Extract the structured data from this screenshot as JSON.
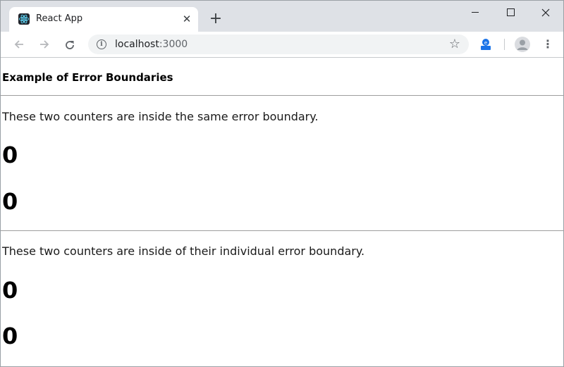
{
  "browser": {
    "tab_title": "React App",
    "new_tab_label": "+",
    "close_tab_label": "✕",
    "url_host": "localhost",
    "url_port": ":3000",
    "icons": {
      "favicon": "react-logo-icon",
      "back": "back-arrow-icon",
      "forward": "forward-arrow-icon",
      "reload": "reload-icon",
      "info": "info-icon",
      "bookmark": "star-icon",
      "extension": "extension-icon",
      "profile": "profile-avatar-icon",
      "menu": "kebab-menu-icon"
    }
  },
  "page": {
    "heading": "Example of Error Boundaries",
    "section1_text": "These two counters are inside the same error boundary.",
    "section2_text": "These two counters are inside of their individual error boundary.",
    "counters": [
      "0",
      "0",
      "0",
      "0"
    ]
  },
  "colors": {
    "tabstrip_bg": "#dee1e6",
    "omnibox_bg": "#f1f3f4",
    "divider": "#9e9e9e"
  }
}
